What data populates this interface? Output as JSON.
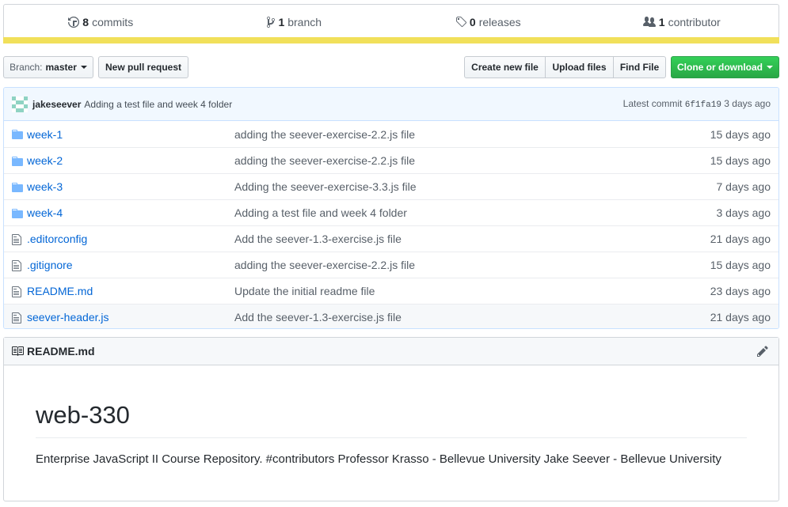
{
  "summary": {
    "commits_count": "8",
    "commits_label": "commits",
    "branch_count": "1",
    "branch_label": "branch",
    "releases_count": "0",
    "releases_label": "releases",
    "contributor_count": "1",
    "contributor_label": "contributor",
    "language_color": "#f1e05a"
  },
  "toolbar": {
    "branch_prefix": "Branch:",
    "branch_name": "master",
    "new_pull_request": "New pull request",
    "create_new_file": "Create new file",
    "upload_files": "Upload files",
    "find_file": "Find File",
    "clone_or_download": "Clone or download"
  },
  "latest_commit": {
    "author": "jakeseever",
    "message": "Adding a test file and week 4 folder",
    "prefix": "Latest commit",
    "sha": "6f1fa19",
    "age": "3 days ago"
  },
  "files": [
    {
      "type": "folder",
      "name": "week-1",
      "message": "adding the seever-exercise-2.2.js file",
      "age": "15 days ago"
    },
    {
      "type": "folder",
      "name": "week-2",
      "message": "adding the seever-exercise-2.2.js file",
      "age": "15 days ago"
    },
    {
      "type": "folder",
      "name": "week-3",
      "message": "Adding the seever-exercise-3.3.js file",
      "age": "7 days ago"
    },
    {
      "type": "folder",
      "name": "week-4",
      "message": "Adding a test file and week 4 folder",
      "age": "3 days ago"
    },
    {
      "type": "file",
      "name": ".editorconfig",
      "message": "Add the seever-1.3-exercise.js file",
      "age": "21 days ago"
    },
    {
      "type": "file",
      "name": ".gitignore",
      "message": "adding the seever-exercise-2.2.js file",
      "age": "15 days ago"
    },
    {
      "type": "file",
      "name": "README.md",
      "message": "Update the initial readme file",
      "age": "23 days ago"
    },
    {
      "type": "file",
      "name": "seever-header.js",
      "message": "Add the seever-1.3-exercise.js file",
      "age": "21 days ago"
    }
  ],
  "readme": {
    "filename": "README.md",
    "heading": "web-330",
    "body": "Enterprise JavaScript II Course Repository. #contributors Professor Krasso - Bellevue University Jake Seever - Bellevue University"
  }
}
